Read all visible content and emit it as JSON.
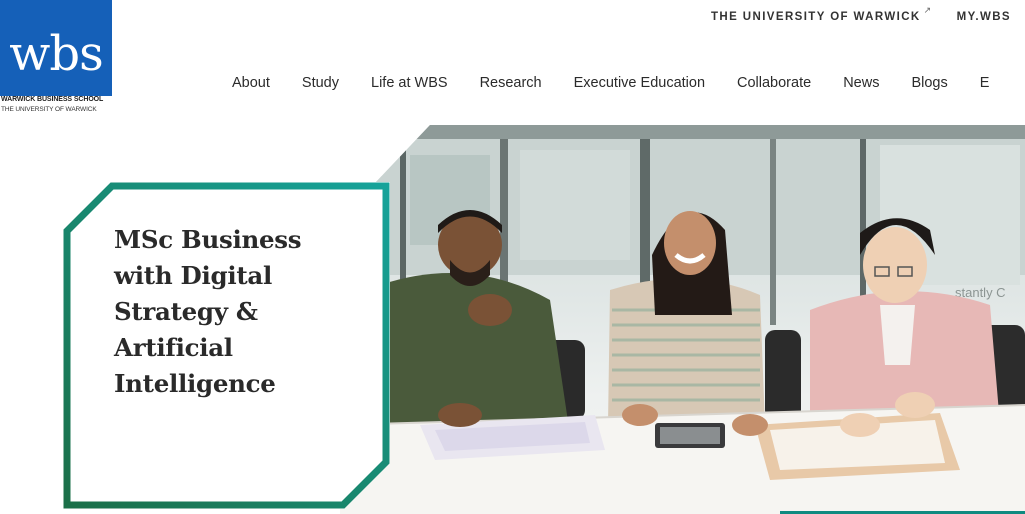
{
  "logo": {
    "wordmark": "wbs",
    "line1": "WARWICK BUSINESS SCHOOL",
    "line2": "THE UNIVERSITY OF WARWICK"
  },
  "utility_nav": {
    "university_link": "THE UNIVERSITY OF WARWICK",
    "external_icon": "external-link-icon",
    "mywbs_link": "MY.WBS"
  },
  "main_nav": {
    "items": [
      "About",
      "Study",
      "Life at WBS",
      "Research",
      "Executive Education",
      "Collaborate",
      "News",
      "Blogs",
      "E"
    ]
  },
  "hero": {
    "title_lines": [
      "MSc Business",
      "with Digital",
      "Strategy &",
      "Artificial",
      "Intelligence"
    ],
    "window_text": "stantly C"
  },
  "colors": {
    "brand_blue": "#1560b8",
    "frame_green": "#1b6f48",
    "frame_teal": "#16a39a"
  }
}
